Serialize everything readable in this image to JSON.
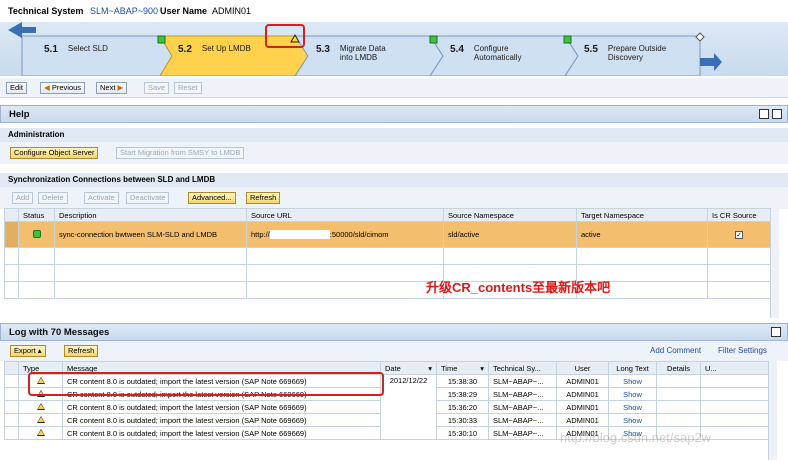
{
  "header": {
    "tech_system_label": "Technical System",
    "tech_system_value": "SLM~ABAP~900",
    "user_label": "User Name",
    "user_value": "ADMIN01"
  },
  "roadmap": {
    "steps": [
      {
        "num": "5.1",
        "label": "Select SLD"
      },
      {
        "num": "5.2",
        "label": "Set Up LMDB"
      },
      {
        "num": "5.3",
        "label": "Migrate Data into LMDB"
      },
      {
        "num": "5.4",
        "label": "Configure Automatically"
      },
      {
        "num": "5.5",
        "label": "Prepare Outside Discovery"
      }
    ]
  },
  "toolbar": {
    "edit": "Edit",
    "previous": "Previous",
    "next": "Next",
    "save": "Save",
    "reset": "Reset"
  },
  "help": {
    "title": "Help"
  },
  "admin": {
    "title": "Administration",
    "configure_btn": "Configure Object Server",
    "start_migration_btn": "Start Migration from SMSY to LMDB"
  },
  "sync": {
    "title": "Synchronization Connections between SLD and LMDB",
    "buttons": {
      "add": "Add",
      "delete": "Delete",
      "activate": "Activate",
      "deactivate": "Deactivate",
      "advanced": "Advanced...",
      "refresh": "Refresh"
    },
    "columns": [
      "Status",
      "Description",
      "Source URL",
      "Source Namespace",
      "Target Namespace",
      "Is CR Source"
    ],
    "row": {
      "description": "sync-connection bwtween SLM-SLD and LMDB",
      "url_prefix": "http://",
      "url_suffix": ":50000/sld/cimom",
      "source_ns": "sld/active",
      "target_ns": "active"
    }
  },
  "annotation": "升级CR_contents至最新版本吧",
  "log": {
    "title": "Log with 70 Messages",
    "export": "Export",
    "refresh": "Refresh",
    "add_comment": "Add Comment",
    "filter_settings": "Filter Settings",
    "columns": [
      "Type",
      "Message",
      "Date",
      "Time",
      "Technical Sy...",
      "User",
      "Long Text",
      "Details",
      "U..."
    ],
    "date": "2012/12/22",
    "rows": [
      {
        "message": "CR content 8.0 is outdated; import the latest version (SAP Note 669669)",
        "time": "15:38:30",
        "system": "SLM~ABAP~...",
        "user": "ADMIN01",
        "long": "Show"
      },
      {
        "message": "CR content 8.0 is outdated; import the latest version (SAP Note 669669)",
        "time": "15:38:29",
        "system": "SLM~ABAP~...",
        "user": "ADMIN01",
        "long": "Show"
      },
      {
        "message": "CR content 8.0 is outdated; import the latest version (SAP Note 669669)",
        "time": "15:36:20",
        "system": "SLM~ABAP~...",
        "user": "ADMIN01",
        "long": "Show"
      },
      {
        "message": "CR content 8.0 is outdated; import the latest version (SAP Note 669669)",
        "time": "15:30:33",
        "system": "SLM~ABAP~...",
        "user": "ADMIN01",
        "long": "Show"
      },
      {
        "message": "CR content 8.0 is outdated; import the latest version (SAP Note 669669)",
        "time": "15:30:10",
        "system": "SLM~ABAP~...",
        "user": "ADMIN01",
        "long": "Show"
      }
    ]
  },
  "watermark": "http://blog.csdn.net/sap2w"
}
